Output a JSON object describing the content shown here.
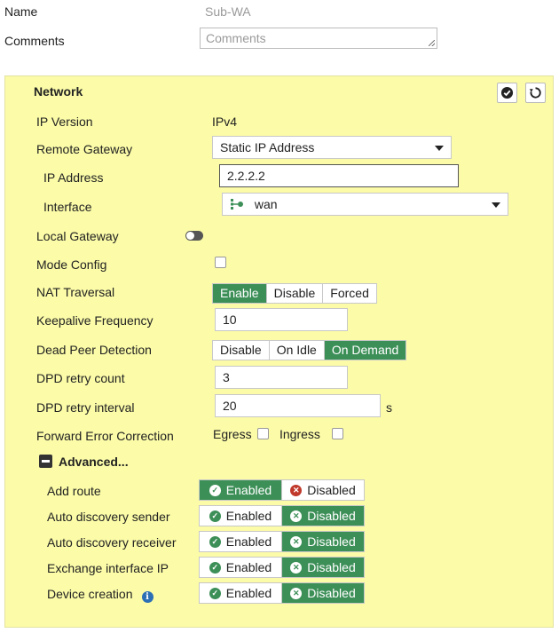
{
  "top": {
    "name_label": "Name",
    "name_value": "Sub-WA",
    "comments_label": "Comments",
    "comments_placeholder": "Comments"
  },
  "network": {
    "title": "Network",
    "ip_version_label": "IP Version",
    "ip_version_value": "IPv4",
    "remote_gateway_label": "Remote Gateway",
    "remote_gateway_value": "Static IP Address",
    "ip_address_label": "IP Address",
    "ip_address_value": "2.2.2.2",
    "interface_label": "Interface",
    "interface_value": "wan",
    "local_gateway_label": "Local Gateway",
    "mode_config_label": "Mode Config",
    "nat_traversal_label": "NAT Traversal",
    "nat_traversal_options": [
      "Enable",
      "Disable",
      "Forced"
    ],
    "nat_traversal_selected": "Enable",
    "keepalive_label": "Keepalive Frequency",
    "keepalive_value": "10",
    "dpd_label": "Dead Peer Detection",
    "dpd_options": [
      "Disable",
      "On Idle",
      "On Demand"
    ],
    "dpd_selected": "On Demand",
    "dpd_retry_count_label": "DPD retry count",
    "dpd_retry_count_value": "3",
    "dpd_retry_interval_label": "DPD retry interval",
    "dpd_retry_interval_value": "20",
    "dpd_retry_interval_unit": "s",
    "fec_label": "Forward Error Correction",
    "fec_egress_label": "Egress",
    "fec_ingress_label": "Ingress",
    "advanced_label": "Advanced...",
    "enabled_label": "Enabled",
    "disabled_label": "Disabled",
    "advanced_rows": [
      {
        "label": "Add route",
        "selected": "Enabled"
      },
      {
        "label": "Auto discovery sender",
        "selected": "Disabled"
      },
      {
        "label": "Auto discovery receiver",
        "selected": "Disabled"
      },
      {
        "label": "Exchange interface IP",
        "selected": "Disabled"
      },
      {
        "label": "Device creation",
        "selected": "Disabled"
      }
    ]
  },
  "colors": {
    "panel_bg": "#fbfba8",
    "active_green": "#3d8f58",
    "disabled_red": "#c0392b",
    "info_blue": "#2d6fb5"
  },
  "icons": [
    "checkmark-circle-icon",
    "revert-icon",
    "caret-down-icon",
    "interface-icon",
    "info-icon",
    "collapse-minus-icon",
    "check-circle-icon",
    "x-circle-icon"
  ]
}
